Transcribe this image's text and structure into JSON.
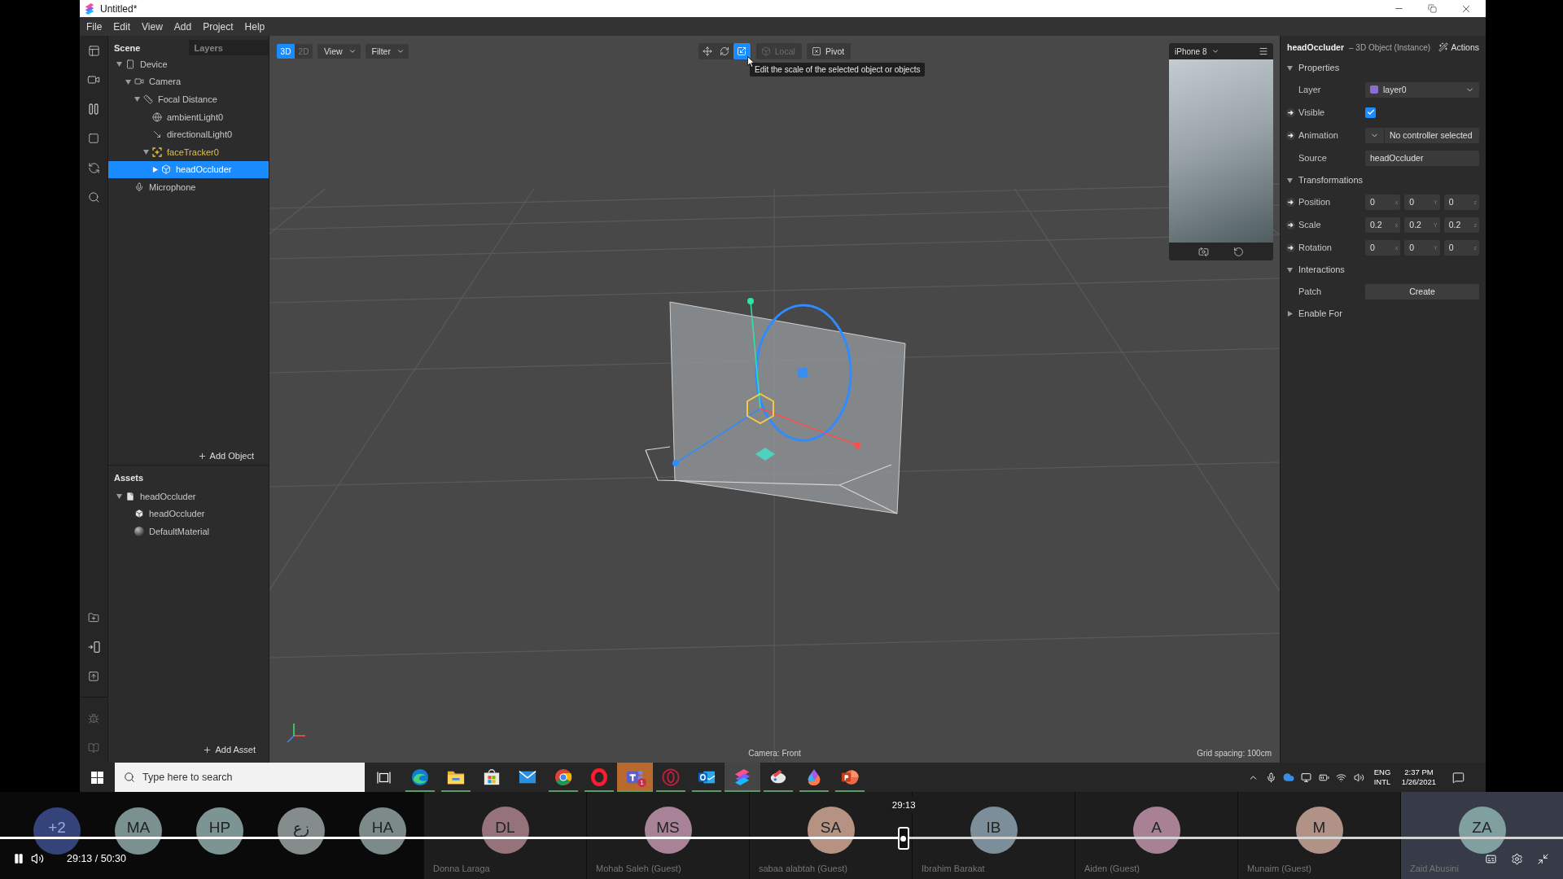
{
  "window": {
    "title": "Untitled*"
  },
  "menu": [
    "File",
    "Edit",
    "View",
    "Add",
    "Project",
    "Help"
  ],
  "scene_panel": {
    "tabs": [
      {
        "label": "Scene",
        "selected": true
      },
      {
        "label": "Layers",
        "selected": false
      }
    ],
    "tree": [
      {
        "label": "Device",
        "kind": "device",
        "expanded": true,
        "selected": false,
        "children": [
          {
            "label": "Camera",
            "kind": "camera",
            "expanded": true,
            "selected": false,
            "children": [
              {
                "label": "Focal Distance",
                "kind": "focal_distance",
                "expanded": true,
                "selected": false,
                "children": [
                  {
                    "label": "ambientLight0",
                    "kind": "ambient_light",
                    "selected": false
                  },
                  {
                    "label": "directionalLight0",
                    "kind": "directional_light",
                    "selected": false
                  },
                  {
                    "label": "faceTracker0",
                    "kind": "face_tracker",
                    "expanded": true,
                    "selected": false,
                    "children": [
                      {
                        "label": "headOccluder",
                        "kind": "object",
                        "expanded": false,
                        "selected": true
                      }
                    ]
                  }
                ]
              }
            ]
          },
          {
            "label": "Microphone",
            "kind": "microphone",
            "selected": false
          }
        ]
      }
    ],
    "add_button": "Add Object"
  },
  "assets_panel": {
    "title": "Assets",
    "tree": [
      {
        "label": "headOccluder",
        "kind": "file",
        "expanded": true,
        "selected": false,
        "children": [
          {
            "label": "headOccluder",
            "kind": "mesh",
            "selected": false
          },
          {
            "label": "DefaultMaterial",
            "kind": "material",
            "selected": false
          }
        ]
      }
    ],
    "add_button": "Add Asset"
  },
  "viewport": {
    "modes": [
      {
        "label": "3D",
        "selected": true
      },
      {
        "label": "2D",
        "selected": false
      }
    ],
    "menus": [
      "View",
      "Filter"
    ],
    "tools": [
      {
        "kind": "move",
        "selected": false
      },
      {
        "kind": "rotate",
        "selected": false
      },
      {
        "kind": "scale",
        "selected": true
      }
    ],
    "local": {
      "label": "Local",
      "disabled": true
    },
    "pivot": {
      "label": "Pivot"
    },
    "tooltip": "Edit the scale of the selected object or objects",
    "camera_label": "Camera: Front",
    "grid_label": "Grid spacing: 100cm"
  },
  "simulator": {
    "device": "iPhone 8"
  },
  "inspector": {
    "title": "headOccluder",
    "subtitle": "– 3D Object (Instance)",
    "actions": "Actions",
    "sections": [
      {
        "title": "Properties",
        "expanded": true,
        "rows": [
          {
            "kind": "dropdown",
            "label": "Layer",
            "value": "layer0",
            "color": "#8a6cd2",
            "patch_arrow": false
          },
          {
            "kind": "checkbox",
            "label": "Visible",
            "checked": true,
            "patch_arrow": true
          },
          {
            "kind": "controller",
            "label": "Animation",
            "value": "No controller selected",
            "patch_arrow": true
          },
          {
            "kind": "text",
            "label": "Source",
            "value": "headOccluder",
            "patch_arrow": false
          }
        ]
      },
      {
        "title": "Transformations",
        "expanded": true,
        "rows": [
          {
            "kind": "vector",
            "label": "Position",
            "patch_arrow": true,
            "fields": [
              {
                "value": "0",
                "axis": "x"
              },
              {
                "value": "0",
                "axis": "Y"
              },
              {
                "value": "0",
                "axis": "z"
              }
            ]
          },
          {
            "kind": "vector",
            "label": "Scale",
            "patch_arrow": true,
            "fields": [
              {
                "value": "0.2",
                "axis": "x"
              },
              {
                "value": "0.2",
                "axis": "Y"
              },
              {
                "value": "0.2",
                "axis": "z"
              }
            ]
          },
          {
            "kind": "vector",
            "label": "Rotation",
            "patch_arrow": true,
            "fields": [
              {
                "value": "0",
                "axis": "x"
              },
              {
                "value": "0",
                "axis": "Y"
              },
              {
                "value": "0",
                "axis": "z"
              }
            ]
          }
        ]
      },
      {
        "title": "Interactions",
        "expanded": true,
        "rows": [
          {
            "kind": "button",
            "label": "Patch",
            "value": "Create",
            "patch_arrow": false
          }
        ]
      },
      {
        "title": "Enable For",
        "expanded": false
      }
    ]
  },
  "taskbar": {
    "search": {
      "placeholder": "Type here to search"
    },
    "apps": [
      {
        "kind": "edge",
        "running": true,
        "active": false,
        "flashing": false
      },
      {
        "kind": "explorer",
        "running": true,
        "active": false,
        "flashing": false
      },
      {
        "kind": "store",
        "running": false,
        "active": false,
        "flashing": false
      },
      {
        "kind": "mail",
        "running": false,
        "active": false,
        "flashing": false
      },
      {
        "kind": "chrome",
        "running": true,
        "active": false,
        "flashing": false
      },
      {
        "kind": "opera",
        "running": true,
        "active": false,
        "flashing": false
      },
      {
        "kind": "teams",
        "running": true,
        "active": false,
        "flashing": true,
        "badge": "1"
      },
      {
        "kind": "opera_gx",
        "running": true,
        "active": false,
        "flashing": false
      },
      {
        "kind": "outlook",
        "running": true,
        "active": false,
        "flashing": false
      },
      {
        "kind": "spark",
        "running": true,
        "active": true,
        "flashing": false
      },
      {
        "kind": "snip",
        "running": true,
        "active": false,
        "flashing": false
      },
      {
        "kind": "drop",
        "running": true,
        "active": false,
        "flashing": false
      },
      {
        "kind": "powerpoint",
        "running": true,
        "active": false,
        "flashing": false
      }
    ],
    "language": "ENG",
    "layout": "INTL",
    "time": "2:37 PM",
    "date": "1/26/2021"
  },
  "meeting": {
    "overflow": [
      {
        "initials": "+2",
        "color": "#34437a"
      },
      {
        "initials": "MA",
        "color": "#7b9090"
      },
      {
        "initials": "HP",
        "color": "#7d9494"
      },
      {
        "initials": "زع",
        "color": "#858c8c"
      },
      {
        "initials": "HA",
        "color": "#7c8a8a"
      }
    ],
    "tiles": [
      {
        "initials": "DL",
        "name": "Donna Laraga",
        "color": "#96727a",
        "highlighted": false
      },
      {
        "initials": "MS",
        "name": "Mohab Saleh (Guest)",
        "color": "#a88296",
        "highlighted": false
      },
      {
        "initials": "SA",
        "name": "sabaa alabtah (Guest)",
        "color": "#b69282",
        "highlighted": false
      },
      {
        "initials": "IB",
        "name": "Ibrahim Barakat",
        "color": "#7c8e9a",
        "highlighted": false
      },
      {
        "initials": "A",
        "name": "Aiden (Guest)",
        "color": "#a88294",
        "highlighted": false
      },
      {
        "initials": "M",
        "name": "Munaim (Guest)",
        "color": "#b09286",
        "highlighted": false
      },
      {
        "initials": "ZA",
        "name": "Zaid Abusini",
        "color": "#80a0a0",
        "highlighted": true
      }
    ]
  },
  "player": {
    "paused": false,
    "time": "29:13 / 50:30",
    "progress": {
      "level": 0.578,
      "tooltip": "29:13"
    }
  }
}
